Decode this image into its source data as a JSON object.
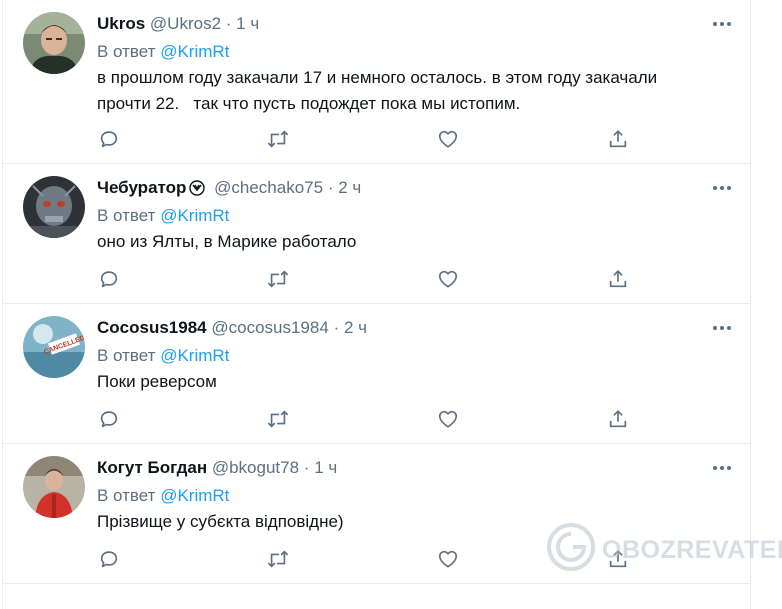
{
  "reply_prefix": "В ответ",
  "time_separator": "·",
  "tweets": [
    {
      "name": "Ukros",
      "handle": "@Ukros2",
      "time": "1 ч",
      "reply_to": "@KrimRt",
      "text_lines": [
        "в прошлом году закачали 17 и немного осталось. в этом году закачали",
        "прочти 22.   так что пусть подождет пока мы истопим."
      ],
      "avatar_icon": "person-avatar-photo"
    },
    {
      "name": "Чебуратор",
      "handle": "@chechako75",
      "time": "2 ч",
      "reply_to": "@KrimRt",
      "text_lines": [
        "оно из Ялты, в Марике работало"
      ],
      "avatar_icon": "robot-skull-avatar"
    },
    {
      "name": "Cocosus1984",
      "handle": "@cocosus1984",
      "time": "2 ч",
      "reply_to": "@KrimRt",
      "text_lines": [
        "Поки реверсом"
      ],
      "avatar_icon": "cancelled-stamp-avatar"
    },
    {
      "name": "Когут Богдан",
      "handle": "@bkogut78",
      "time": "1 ч",
      "reply_to": "@KrimRt",
      "text_lines": [
        "Прізвище у субєкта відповідне)"
      ],
      "avatar_icon": "person-red-jacket-avatar"
    }
  ],
  "watermark": {
    "text": "OBOZREVATEL"
  },
  "colors": {
    "accent": "#1da1f2",
    "secondary_text": "#5b7083",
    "icon": "#5b7083",
    "border": "#e6ecf0"
  }
}
